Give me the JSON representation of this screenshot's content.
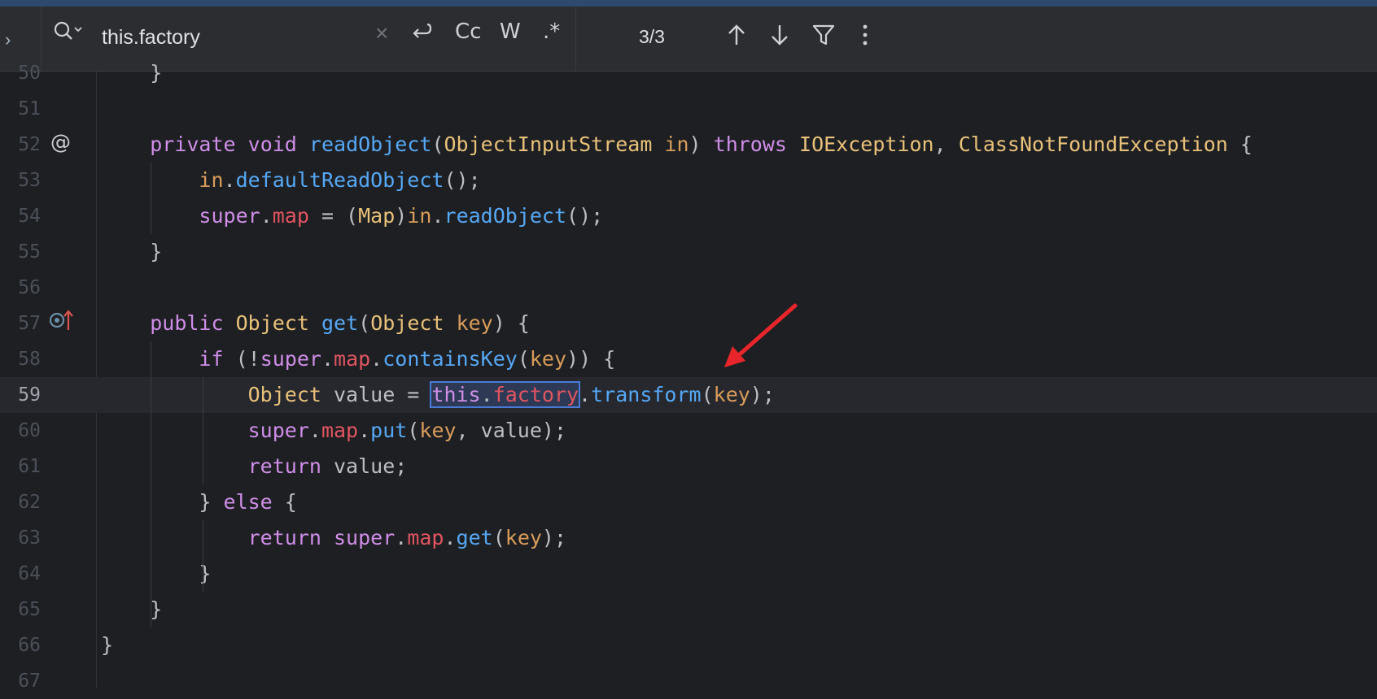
{
  "search": {
    "query": "this.factory",
    "clear_symbol": "×",
    "options": {
      "match_case": "Cc",
      "words": "W",
      "regex": ".*"
    },
    "match_count": "3/3",
    "expand_symbol": "›"
  },
  "gutter": {
    "at_symbol": "@"
  },
  "editor": {
    "lines": [
      {
        "num": "50",
        "text": "    }"
      },
      {
        "num": "51",
        "text": ""
      },
      {
        "num": "52",
        "tokens": [
          [
            "    ",
            "pl"
          ],
          [
            "private",
            "kw"
          ],
          [
            " ",
            "pl"
          ],
          [
            "void",
            "kw"
          ],
          [
            " ",
            "pl"
          ],
          [
            "readObject",
            "fn"
          ],
          [
            "(",
            "pl"
          ],
          [
            "ObjectInputStream",
            "ty"
          ],
          [
            " ",
            "pl"
          ],
          [
            "in",
            "pr"
          ],
          [
            ") ",
            "pl"
          ],
          [
            "throws",
            "kw"
          ],
          [
            " ",
            "pl"
          ],
          [
            "IOException",
            "ty"
          ],
          [
            ", ",
            "pl"
          ],
          [
            "ClassNotFoundException",
            "ty"
          ],
          [
            " {",
            "pl"
          ]
        ]
      },
      {
        "num": "53",
        "tokens": [
          [
            "        ",
            "pl"
          ],
          [
            "in",
            "pr"
          ],
          [
            ".",
            "pl"
          ],
          [
            "defaultReadObject",
            "fn"
          ],
          [
            "();",
            "pl"
          ]
        ]
      },
      {
        "num": "54",
        "tokens": [
          [
            "        ",
            "pl"
          ],
          [
            "super",
            "kw"
          ],
          [
            ".",
            "pl"
          ],
          [
            "map",
            "fd"
          ],
          [
            " = (",
            "pl"
          ],
          [
            "Map",
            "ty"
          ],
          [
            ")",
            "pl"
          ],
          [
            "in",
            "pr"
          ],
          [
            ".",
            "pl"
          ],
          [
            "readObject",
            "fn"
          ],
          [
            "();",
            "pl"
          ]
        ]
      },
      {
        "num": "55",
        "text": "    }"
      },
      {
        "num": "56",
        "text": ""
      },
      {
        "num": "57",
        "tokens": [
          [
            "    ",
            "pl"
          ],
          [
            "public",
            "kw"
          ],
          [
            " ",
            "pl"
          ],
          [
            "Object",
            "ty"
          ],
          [
            " ",
            "pl"
          ],
          [
            "get",
            "fn"
          ],
          [
            "(",
            "pl"
          ],
          [
            "Object",
            "ty"
          ],
          [
            " ",
            "pl"
          ],
          [
            "key",
            "pr"
          ],
          [
            ") {",
            "pl"
          ]
        ]
      },
      {
        "num": "58",
        "tokens": [
          [
            "        ",
            "pl"
          ],
          [
            "if",
            "kw"
          ],
          [
            " (!",
            "pl"
          ],
          [
            "super",
            "kw"
          ],
          [
            ".",
            "pl"
          ],
          [
            "map",
            "fd"
          ],
          [
            ".",
            "pl"
          ],
          [
            "containsKey",
            "fn"
          ],
          [
            "(",
            "pl"
          ],
          [
            "key",
            "pr"
          ],
          [
            ")) {",
            "pl"
          ]
        ]
      },
      {
        "num": "59",
        "current": true,
        "tokens": [
          [
            "            ",
            "pl"
          ],
          [
            "Object",
            "ty"
          ],
          [
            " value = ",
            "pl"
          ],
          [
            "this",
            "kw match-start"
          ],
          [
            ".",
            "pl match-mid"
          ],
          [
            "factory",
            "fd match-end"
          ],
          [
            ".",
            "pl"
          ],
          [
            "transform",
            "fn"
          ],
          [
            "(",
            "pl"
          ],
          [
            "key",
            "pr"
          ],
          [
            ");",
            "pl"
          ]
        ]
      },
      {
        "num": "60",
        "tokens": [
          [
            "            ",
            "pl"
          ],
          [
            "super",
            "kw"
          ],
          [
            ".",
            "pl"
          ],
          [
            "map",
            "fd"
          ],
          [
            ".",
            "pl"
          ],
          [
            "put",
            "fn"
          ],
          [
            "(",
            "pl"
          ],
          [
            "key",
            "pr"
          ],
          [
            ", value);",
            "pl"
          ]
        ]
      },
      {
        "num": "61",
        "tokens": [
          [
            "            ",
            "pl"
          ],
          [
            "return",
            "kw"
          ],
          [
            " value;",
            "pl"
          ]
        ]
      },
      {
        "num": "62",
        "tokens": [
          [
            "        } ",
            "pl"
          ],
          [
            "else",
            "kw"
          ],
          [
            " {",
            "pl"
          ]
        ]
      },
      {
        "num": "63",
        "tokens": [
          [
            "            ",
            "pl"
          ],
          [
            "return",
            "kw"
          ],
          [
            " ",
            "pl"
          ],
          [
            "super",
            "kw"
          ],
          [
            ".",
            "pl"
          ],
          [
            "map",
            "fd"
          ],
          [
            ".",
            "pl"
          ],
          [
            "get",
            "fn"
          ],
          [
            "(",
            "pl"
          ],
          [
            "key",
            "pr"
          ],
          [
            ");",
            "pl"
          ]
        ]
      },
      {
        "num": "64",
        "text": "        }"
      },
      {
        "num": "65",
        "text": "    }"
      },
      {
        "num": "66",
        "text": "}"
      },
      {
        "num": "67",
        "text": ""
      }
    ]
  },
  "colors": {
    "background": "#1e1f22",
    "keyword": "#cf8ee8",
    "function": "#56a8f5",
    "type": "#e8c17a",
    "field": "#e05561",
    "annotation_arrow": "#e8252a"
  }
}
